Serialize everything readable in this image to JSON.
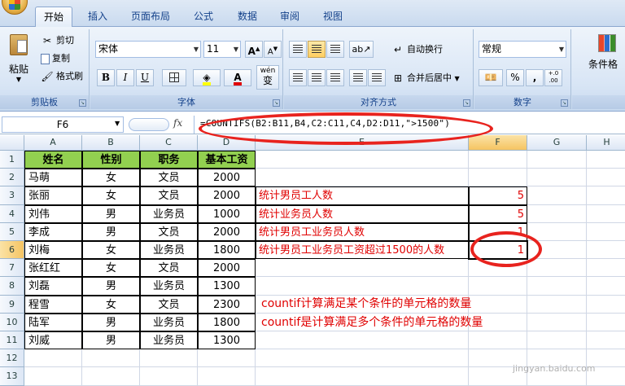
{
  "ribbon_tabs": [
    {
      "label": "开始",
      "active": true
    },
    {
      "label": "插入"
    },
    {
      "label": "页面布局"
    },
    {
      "label": "公式"
    },
    {
      "label": "数据"
    },
    {
      "label": "审阅"
    },
    {
      "label": "视图"
    }
  ],
  "clipboard": {
    "paste": "粘贴",
    "cut": "剪切",
    "copy": "复制",
    "format_painter": "格式刷",
    "group": "剪贴板"
  },
  "font": {
    "name": "宋体",
    "size": "11",
    "group": "字体",
    "bold": "B",
    "italic": "I",
    "underline": "U",
    "grow": "A",
    "shrink": "A",
    "font_color": "A",
    "wen": "wén",
    "wen_char": "变"
  },
  "alignment": {
    "wrap": "自动换行",
    "merge": "合并后居中",
    "group": "对齐方式"
  },
  "number": {
    "format": "常规",
    "percent": "%",
    "comma": ",",
    "inc": "+.0 .00",
    "dec": ".00 +.0",
    "group": "数字"
  },
  "styles": {
    "conditional": "条件格"
  },
  "formula_bar": {
    "name_box": "F6",
    "fx": "fx",
    "formula": "=COUNTIFS(B2:B11,B4,C2:C11,C4,D2:D11,\">1500\")"
  },
  "columns": [
    "A",
    "B",
    "C",
    "D",
    "E",
    "F",
    "G",
    "H"
  ],
  "rows": [
    "1",
    "2",
    "3",
    "4",
    "5",
    "6",
    "7",
    "8",
    "9",
    "10",
    "11",
    "12",
    "13"
  ],
  "table": {
    "headers": [
      "姓名",
      "性别",
      "职务",
      "基本工资"
    ],
    "data": [
      [
        "马萌",
        "女",
        "文员",
        "2000"
      ],
      [
        "张丽",
        "女",
        "文员",
        "2000"
      ],
      [
        "刘伟",
        "男",
        "业务员",
        "1000"
      ],
      [
        "李成",
        "男",
        "文员",
        "2000"
      ],
      [
        "刘梅",
        "女",
        "业务员",
        "1800"
      ],
      [
        "张红红",
        "女",
        "文员",
        "2000"
      ],
      [
        "刘磊",
        "男",
        "业务员",
        "1300"
      ],
      [
        "程雪",
        "女",
        "文员",
        "2300"
      ],
      [
        "陆军",
        "男",
        "业务员",
        "1800"
      ],
      [
        "刘威",
        "男",
        "业务员",
        "1300"
      ]
    ]
  },
  "stats": [
    {
      "label": "统计男员工人数",
      "value": "5"
    },
    {
      "label": "统计业务员人数",
      "value": "5"
    },
    {
      "label": "统计男员工业务员人数",
      "value": "1"
    },
    {
      "label": "统计男员工业务员工资超过1500的人数",
      "value": "1"
    }
  ],
  "notes": [
    "countif计算满足某个条件的单元格的数量",
    "countif是计算满足多个条件的单元格的数量"
  ],
  "watermark": "jingyan.baidu.com",
  "colors": {
    "header_fill": "#92d050",
    "annotation_red": "#e00000",
    "oval_red": "#e8231e"
  }
}
